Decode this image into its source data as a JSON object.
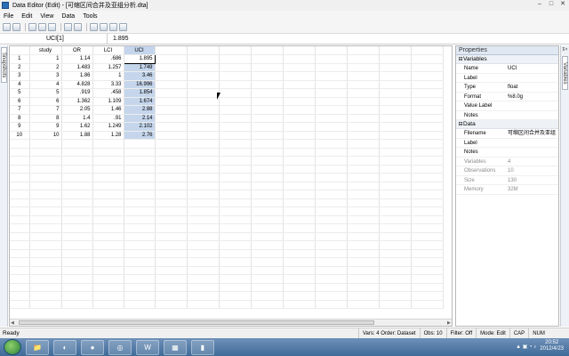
{
  "window": {
    "title": "Data Editor (Edit) - [可缩区间合并及亚组分析.dta]"
  },
  "menu": [
    "File",
    "Edit",
    "View",
    "Data",
    "Tools"
  ],
  "toolbar": {
    "buttons": [
      "open-icon",
      "save-icon",
      "print-icon",
      "copy-icon",
      "paste-icon",
      "edit-mode-icon",
      "browse-mode-icon",
      "filter-icon",
      "variables-icon",
      "properties-icon",
      "snapshots-icon"
    ]
  },
  "cellbar": {
    "ref": "UCI[1]",
    "value": "1.895"
  },
  "grid": {
    "headers": [
      "study",
      "OR",
      "LCI",
      "UCI"
    ],
    "rows": [
      [
        "1",
        "1.14",
        ".686",
        "1.895"
      ],
      [
        "2",
        "1.483",
        "1.257",
        "1.749"
      ],
      [
        "3",
        "1.86",
        "1",
        "3.46"
      ],
      [
        "4",
        "4.828",
        "3.33",
        "16.996"
      ],
      [
        "5",
        ".919",
        ".458",
        "1.854"
      ],
      [
        "6",
        "1.362",
        "1.109",
        "1.674"
      ],
      [
        "7",
        "2.05",
        "1.46",
        "2.88"
      ],
      [
        "8",
        "1.4",
        ".91",
        "2.14"
      ],
      [
        "9",
        "1.62",
        "1.249",
        "2.102"
      ],
      [
        "10",
        "1.88",
        "1.28",
        "2.76"
      ]
    ],
    "row_numbers": [
      "1",
      "2",
      "3",
      "4",
      "5",
      "6",
      "7",
      "8",
      "9",
      "10"
    ]
  },
  "properties": {
    "title": "Properties",
    "variables_section": "Variables",
    "variables": [
      {
        "key": "Name",
        "value": "UCI"
      },
      {
        "key": "Label",
        "value": ""
      },
      {
        "key": "Type",
        "value": "float"
      },
      {
        "key": "Format",
        "value": "%8.0g"
      },
      {
        "key": "Value Label",
        "value": ""
      },
      {
        "key": "Notes",
        "value": ""
      }
    ],
    "data_section": "Data",
    "data": [
      {
        "key": "Filename",
        "value": "可缩区间合并及亚组"
      },
      {
        "key": "Label",
        "value": ""
      },
      {
        "key": "Notes",
        "value": ""
      },
      {
        "key": "Variables",
        "value": "4"
      },
      {
        "key": "Observations",
        "value": "10"
      },
      {
        "key": "Size",
        "value": "130"
      },
      {
        "key": "Memory",
        "value": "32M"
      }
    ]
  },
  "lefttab": "Snapshots",
  "righttab": "Variables",
  "status": {
    "ready": "Ready",
    "vars": "Vars: 4  Order: Dataset",
    "obs": "Obs: 10",
    "filter": "Filter: Off",
    "mode": "Mode: Edit",
    "cap": "CAP",
    "num": "NUM"
  },
  "taskbar": {
    "time": "20:52",
    "date": "2012/4/23"
  }
}
